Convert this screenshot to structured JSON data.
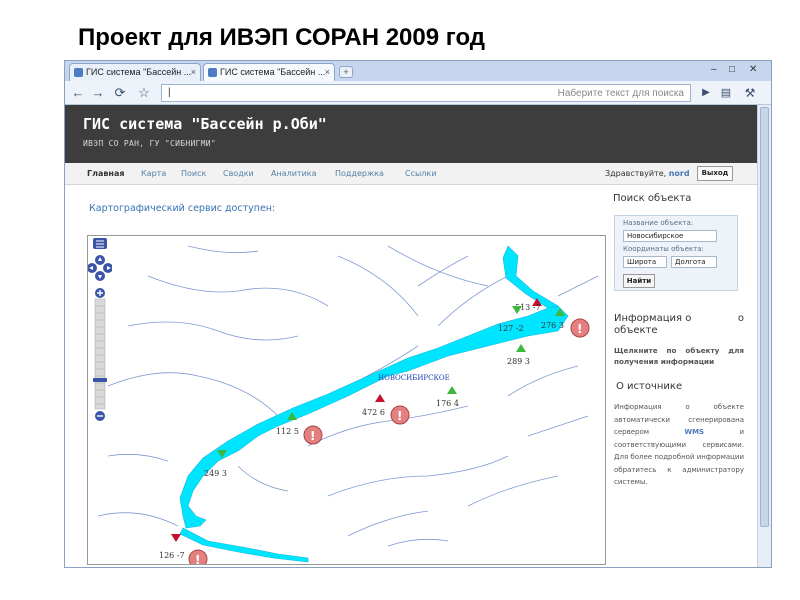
{
  "slide_title": "Проект для ИВЭП СОРАН 2009 год",
  "browser": {
    "tabs": [
      {
        "label": "ГИС система \"Бассейн ..."
      },
      {
        "label": "ГИС система \"Бассейн ..."
      }
    ],
    "address": "|",
    "address_placeholder": "Наберите текст для поиска"
  },
  "site": {
    "title": "ГИС система \"Бассейн р.Оби\"",
    "subtitle": "ИВЭП СО РАН, ГУ \"СИБНИГМИ\"",
    "menu": [
      "Главная",
      "Карта",
      "Поиск",
      "Сводки",
      "Аналитика",
      "Поддержка",
      "Ссылки"
    ],
    "greeting_prefix": "Здравствуйте,",
    "user": "nord",
    "logout": "Выход"
  },
  "map_section": {
    "status": "Картографический сервис доступен:",
    "city_label": "НОВОСИБИРСКОЕ",
    "stations": [
      {
        "label": "513 -7",
        "kind": "red-up"
      },
      {
        "label": "127 -2",
        "kind": "green-down"
      },
      {
        "label": "276 3",
        "kind": "green-up"
      },
      {
        "label": "289 3",
        "kind": "green-up"
      },
      {
        "label": "176 4",
        "kind": "green-up"
      },
      {
        "label": "472 6",
        "kind": "red-up"
      },
      {
        "label": "112 5",
        "kind": "green-up"
      },
      {
        "label": "249 3",
        "kind": "green-down"
      },
      {
        "label": "126 -7",
        "kind": "red-down"
      }
    ]
  },
  "object_search": {
    "title": "Поиск объекта",
    "name_label": "Название объекта:",
    "name_value": "Новосибирское",
    "coords_label": "Координаты объекта:",
    "lat_value": "Широта",
    "lon_value": "Долгота",
    "find_button": "Найти"
  },
  "info": {
    "title": "Информация о объекте",
    "title_o": "о",
    "text": "Щелкните по объекту для получения информации"
  },
  "source": {
    "title": "О источнике",
    "text_1": "Информация о объекте автоматически сгенерирована сервером",
    "text_wms": "WMS",
    "text_2": "и соответствующими сервисами. Для более подробной информации обратитесь к администратору системы."
  },
  "colors": {
    "banner": "#3d3d3d",
    "water": "#00e5ff",
    "river": "#6f8fc8",
    "link": "#5580a8",
    "alert": "#e07070",
    "green_marker": "#3cb83c",
    "red_marker": "#c8102e"
  }
}
